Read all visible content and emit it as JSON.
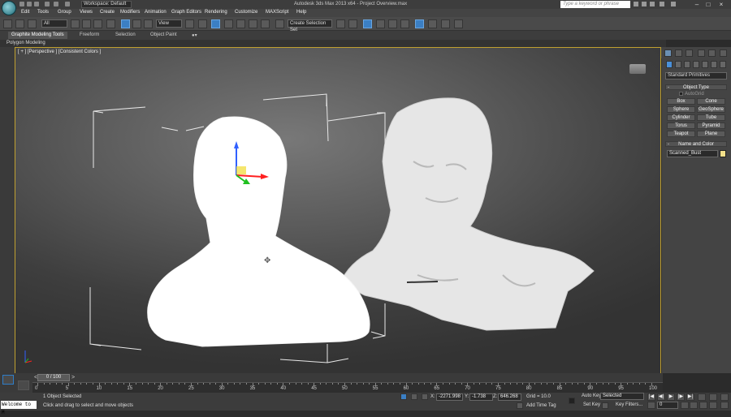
{
  "app": {
    "workspace": "Workspace: Default",
    "title": "Autodesk 3ds Max 2013 x64 - Project Overview.max",
    "search_placeholder": "Type a keyword or phrase"
  },
  "menu": [
    "Edit",
    "Tools",
    "Group",
    "Views",
    "Create",
    "Modifiers",
    "Animation",
    "Graph Editors",
    "Rendering",
    "Customize",
    "MAXScript",
    "Help"
  ],
  "toolbar": {
    "filter_select": "All",
    "ref_coord": "View",
    "named_selection": "Create Selection Set"
  },
  "ribbon": {
    "tabs": [
      "Graphite Modeling Tools",
      "Freeform",
      "Selection",
      "Object Paint"
    ],
    "panel_label": "Polygon Modeling"
  },
  "viewport": {
    "label": "[ + ] [Perspective ] [Consistent Colors ]"
  },
  "command_panel": {
    "category_dropdown": "Standard Primitives",
    "object_type_title": "Object Type",
    "autogrid_label": "AutoGrid",
    "primitives": [
      "Box",
      "Cone",
      "Sphere",
      "GeoSphere",
      "Cylinder",
      "Tube",
      "Torus",
      "Pyramid",
      "Teapot",
      "Plane"
    ],
    "name_color_title": "Name and Color",
    "object_name": "Scanned_Bust",
    "object_color": "#f2e08a"
  },
  "timeline": {
    "frame_display": "0 / 100",
    "ticks": [
      0,
      5,
      10,
      15,
      20,
      25,
      30,
      35,
      40,
      45,
      50,
      55,
      60,
      65,
      70,
      75,
      80,
      85,
      90,
      95,
      100
    ]
  },
  "status": {
    "maxscript_text": "Welcome to M",
    "selection_info": "1 Object Selected",
    "prompt": "Click and drag to select and move objects",
    "x_label": "X:",
    "x_value": "-2271.998",
    "y_label": "Y:",
    "y_value": "-1.738",
    "z_label": "Z:",
    "z_value": "646.268",
    "grid": "Grid = 10.0",
    "add_time_tag": "Add Time Tag",
    "auto_key": "Auto Key",
    "auto_key_select": "Selected",
    "set_key": "Set Key",
    "key_filters": "Key Filters...",
    "current_frame": "0"
  }
}
